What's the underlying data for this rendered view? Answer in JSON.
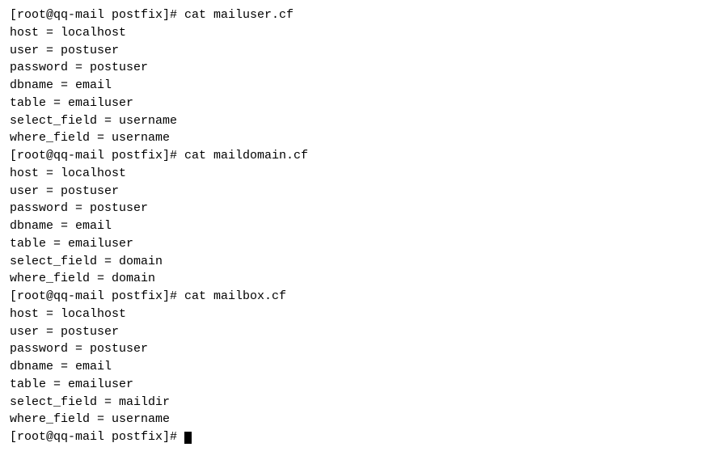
{
  "terminal": {
    "lines": [
      {
        "type": "prompt",
        "text": "[root@qq-mail postfix]# cat mailuser.cf"
      },
      {
        "type": "output",
        "text": "host = localhost"
      },
      {
        "type": "output",
        "text": "user = postuser"
      },
      {
        "type": "output",
        "text": "password = postuser"
      },
      {
        "type": "output",
        "text": "dbname = email"
      },
      {
        "type": "output",
        "text": "table = emailuser"
      },
      {
        "type": "output",
        "text": "select_field = username"
      },
      {
        "type": "output",
        "text": "where_field = username"
      },
      {
        "type": "prompt",
        "text": "[root@qq-mail postfix]# cat maildomain.cf"
      },
      {
        "type": "output",
        "text": "host = localhost"
      },
      {
        "type": "output",
        "text": "user = postuser"
      },
      {
        "type": "output",
        "text": "password = postuser"
      },
      {
        "type": "output",
        "text": "dbname = email"
      },
      {
        "type": "output",
        "text": "table = emailuser"
      },
      {
        "type": "output",
        "text": "select_field = domain"
      },
      {
        "type": "output",
        "text": "where_field = domain"
      },
      {
        "type": "prompt",
        "text": "[root@qq-mail postfix]# cat mailbox.cf"
      },
      {
        "type": "output",
        "text": "host = localhost"
      },
      {
        "type": "output",
        "text": "user = postuser"
      },
      {
        "type": "output",
        "text": "password = postuser"
      },
      {
        "type": "output",
        "text": "dbname = email"
      },
      {
        "type": "output",
        "text": "table = emailuser"
      },
      {
        "type": "output",
        "text": "select_field = maildir"
      },
      {
        "type": "output",
        "text": "where_field = username"
      },
      {
        "type": "prompt_cursor",
        "text": "[root@qq-mail postfix]# "
      }
    ]
  }
}
